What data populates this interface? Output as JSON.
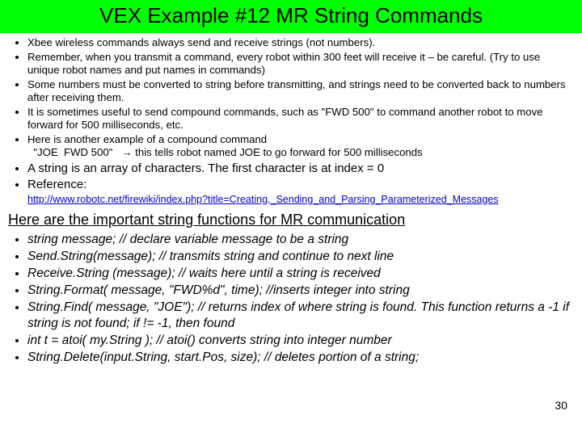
{
  "title": "VEX Example #12 MR String Commands",
  "top_bullets": [
    "Xbee wireless commands always send and receive strings (not numbers).",
    "Remember, when you transmit a command, every robot within 300 feet will receive it – be careful.  (Try to use unique robot names and put names in commands)",
    "Some numbers must be converted to string before transmitting, and strings need to be converted back to numbers after receiving them.",
    "It is sometimes useful to send compound commands, such as \"FWD 500\" to command another robot to move forward for 500 milliseconds, etc.",
    "Here is another example of a compound command\n  \"JOE  FWD 500\"   → this tells robot named JOE to go forward for 500 milliseconds"
  ],
  "mid_bullets": [
    "A string is an array of characters. The first character is at index = 0",
    "Reference:"
  ],
  "reference_url": "http://www.robotc.net/firewiki/index.php?title=Creating,_Sending_and_Parsing_Parameterized_Messages",
  "section_heading": "Here are the important string functions for MR communication",
  "fn_bullets": [
    "string message;  // declare variable message to be a string",
    "Send.String(message);  // transmits string and continue to next line",
    "Receive.String (message);   // waits here until a string is received",
    "String.Format( message, \"FWD%d\", time);  //inserts integer into string",
    "String.Find( message, \"JOE\");  // returns index of where string is found.  This function returns a -1 if string is not found;    if != -1, then found",
    " int t = atoi( my.String );  //  atoi() converts string into integer number",
    "String.Delete(input.String, start.Pos, size);  // deletes portion of a string;"
  ],
  "slide_number": "30"
}
